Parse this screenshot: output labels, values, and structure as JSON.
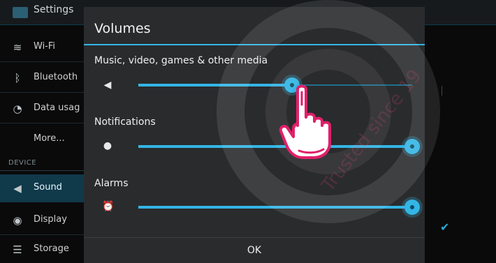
{
  "background": {
    "header_title": "Settings",
    "items": [
      {
        "label": "Wi-Fi",
        "icon": "wifi-icon",
        "glyph": "≋"
      },
      {
        "label": "Bluetooth",
        "icon": "bluetooth-icon",
        "glyph": "ᛒ"
      },
      {
        "label": "Data usag",
        "icon": "data-usage-icon",
        "glyph": "◔"
      },
      {
        "label": "More...",
        "icon": "",
        "glyph": ""
      }
    ],
    "section": "DEVICE",
    "device_items": [
      {
        "label": "Sound",
        "icon": "speaker-icon",
        "glyph": "◀"
      },
      {
        "label": "Display",
        "icon": "display-icon",
        "glyph": "◉"
      },
      {
        "label": "Storage",
        "icon": "storage-icon",
        "glyph": "☰"
      }
    ]
  },
  "dialog": {
    "title": "Volumes",
    "sliders": [
      {
        "label": "Music, video, games & other media",
        "icon": "media-volume-icon",
        "glyph": "◀",
        "level": 0.56
      },
      {
        "label": "Notifications",
        "icon": "notification-icon",
        "glyph": "●",
        "level": 1.0
      },
      {
        "label": "Alarms",
        "icon": "alarm-clock-icon",
        "glyph": "⏰",
        "level": 1.0
      }
    ],
    "ok_label": "OK"
  },
  "watermark": {
    "lines": [
      "Trusted since 19"
    ]
  },
  "colors": {
    "accent": "#33b5e5",
    "dialog_bg": "#2a2b2d",
    "hand": "#e0206a"
  }
}
